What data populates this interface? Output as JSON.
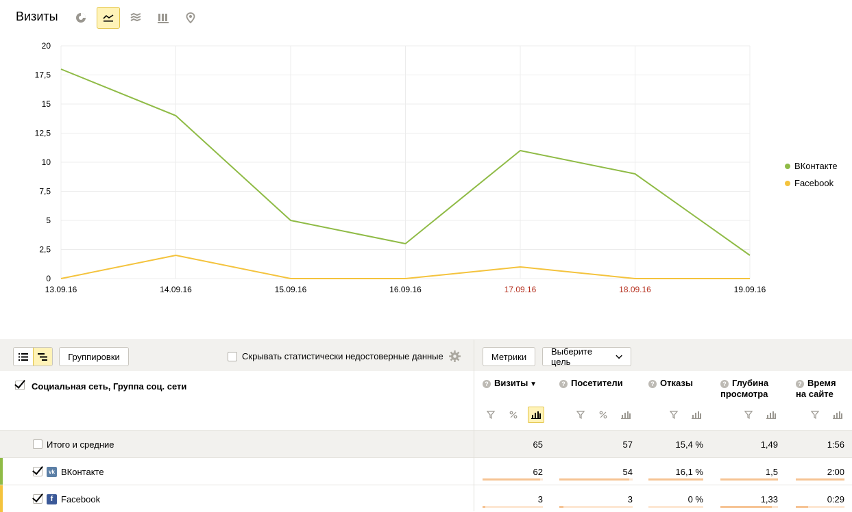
{
  "header": {
    "title": "Визиты",
    "view_icons": [
      "pie-chart-icon",
      "line-chart-icon",
      "area-chart-icon",
      "bar-chart-icon",
      "map-icon"
    ],
    "active_view": "line-chart-icon"
  },
  "chart_data": {
    "type": "line",
    "x": [
      "13.09.16",
      "14.09.16",
      "15.09.16",
      "16.09.16",
      "17.09.16",
      "18.09.16",
      "19.09.16"
    ],
    "weekend_x": [
      "17.09.16",
      "18.09.16"
    ],
    "yticks": [
      "0",
      "2,5",
      "5",
      "7,5",
      "10",
      "12,5",
      "15",
      "17,5",
      "20"
    ],
    "ylim": [
      0,
      20
    ],
    "series": [
      {
        "name": "ВКонтакте",
        "color": "#8fbb46",
        "values": [
          18,
          14,
          5,
          3,
          11,
          9,
          2
        ]
      },
      {
        "name": "Facebook",
        "color": "#f4c33d",
        "values": [
          0,
          2,
          0,
          0,
          1,
          0,
          0
        ]
      }
    ],
    "legend": "right",
    "grid": true
  },
  "toolbar": {
    "groupings_label": "Группировки",
    "hide_unreliable_label": "Скрывать статистически недостоверные данные",
    "metrics_label": "Метрики",
    "goal_select_label": "Выберите цель"
  },
  "table": {
    "dimension_title": "Социальная сеть, Группа соц. сети",
    "columns": [
      {
        "label": "Визиты",
        "line2": "",
        "sort": "▼"
      },
      {
        "label": "Посетители",
        "line2": "",
        "sort": ""
      },
      {
        "label": "Отказы",
        "line2": "",
        "sort": ""
      },
      {
        "label": "Глубина",
        "line2": "просмотра",
        "sort": ""
      },
      {
        "label": "Время",
        "line2": "на сайте",
        "sort": ""
      }
    ],
    "total": {
      "label": "Итого и средние",
      "values": [
        "65",
        "57",
        "15,4 %",
        "1,49",
        "1:56"
      ]
    },
    "rows": [
      {
        "label": "ВКонтакте",
        "icon": "vk-icon",
        "accent": "#8fbb46",
        "values": [
          "62",
          "54",
          "16,1 %",
          "1,5",
          "2:00"
        ],
        "bars": [
          0.95,
          0.95,
          1.0,
          1.0,
          1.0
        ]
      },
      {
        "label": "Facebook",
        "icon": "facebook-icon",
        "accent": "#f4c33d",
        "values": [
          "3",
          "3",
          "0 %",
          "1,33",
          "0:29"
        ],
        "bars": [
          0.05,
          0.06,
          0.0,
          0.89,
          0.25
        ]
      }
    ]
  }
}
